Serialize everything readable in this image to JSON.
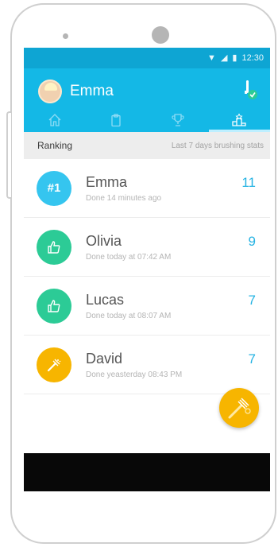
{
  "status_bar": {
    "time": "12:30"
  },
  "header": {
    "user_name": "Emma"
  },
  "tabs": [
    {
      "icon": "home-icon"
    },
    {
      "icon": "clipboard-icon"
    },
    {
      "icon": "trophy-icon"
    },
    {
      "icon": "podium-icon",
      "active": true
    }
  ],
  "ranking": {
    "title": "Ranking",
    "subtitle": "Last 7 days brushing stats"
  },
  "rows": [
    {
      "name": "Emma",
      "detail": "Done 14 minutes ago",
      "score": "11",
      "badge_text": "#1",
      "badge_color": "#35c5ef",
      "badge_icon": "rank-badge"
    },
    {
      "name": "Olivia",
      "detail": "Done today at  07:42 AM",
      "score": "9",
      "badge_color": "#2ccb96",
      "badge_icon": "thumbs-up-icon"
    },
    {
      "name": "Lucas",
      "detail": "Done today at 08:07 AM",
      "score": "7",
      "badge_color": "#2ccb96",
      "badge_icon": "thumbs-up-icon"
    },
    {
      "name": "David",
      "detail": "Done yeasterday 08:43 PM",
      "score": "7",
      "badge_color": "#f7b500",
      "badge_icon": "toothbrush-icon"
    }
  ],
  "colors": {
    "status_bar": "#0ea5d3",
    "header": "#14b8e6",
    "score": "#26b3e3",
    "fab": "#f7b500"
  }
}
